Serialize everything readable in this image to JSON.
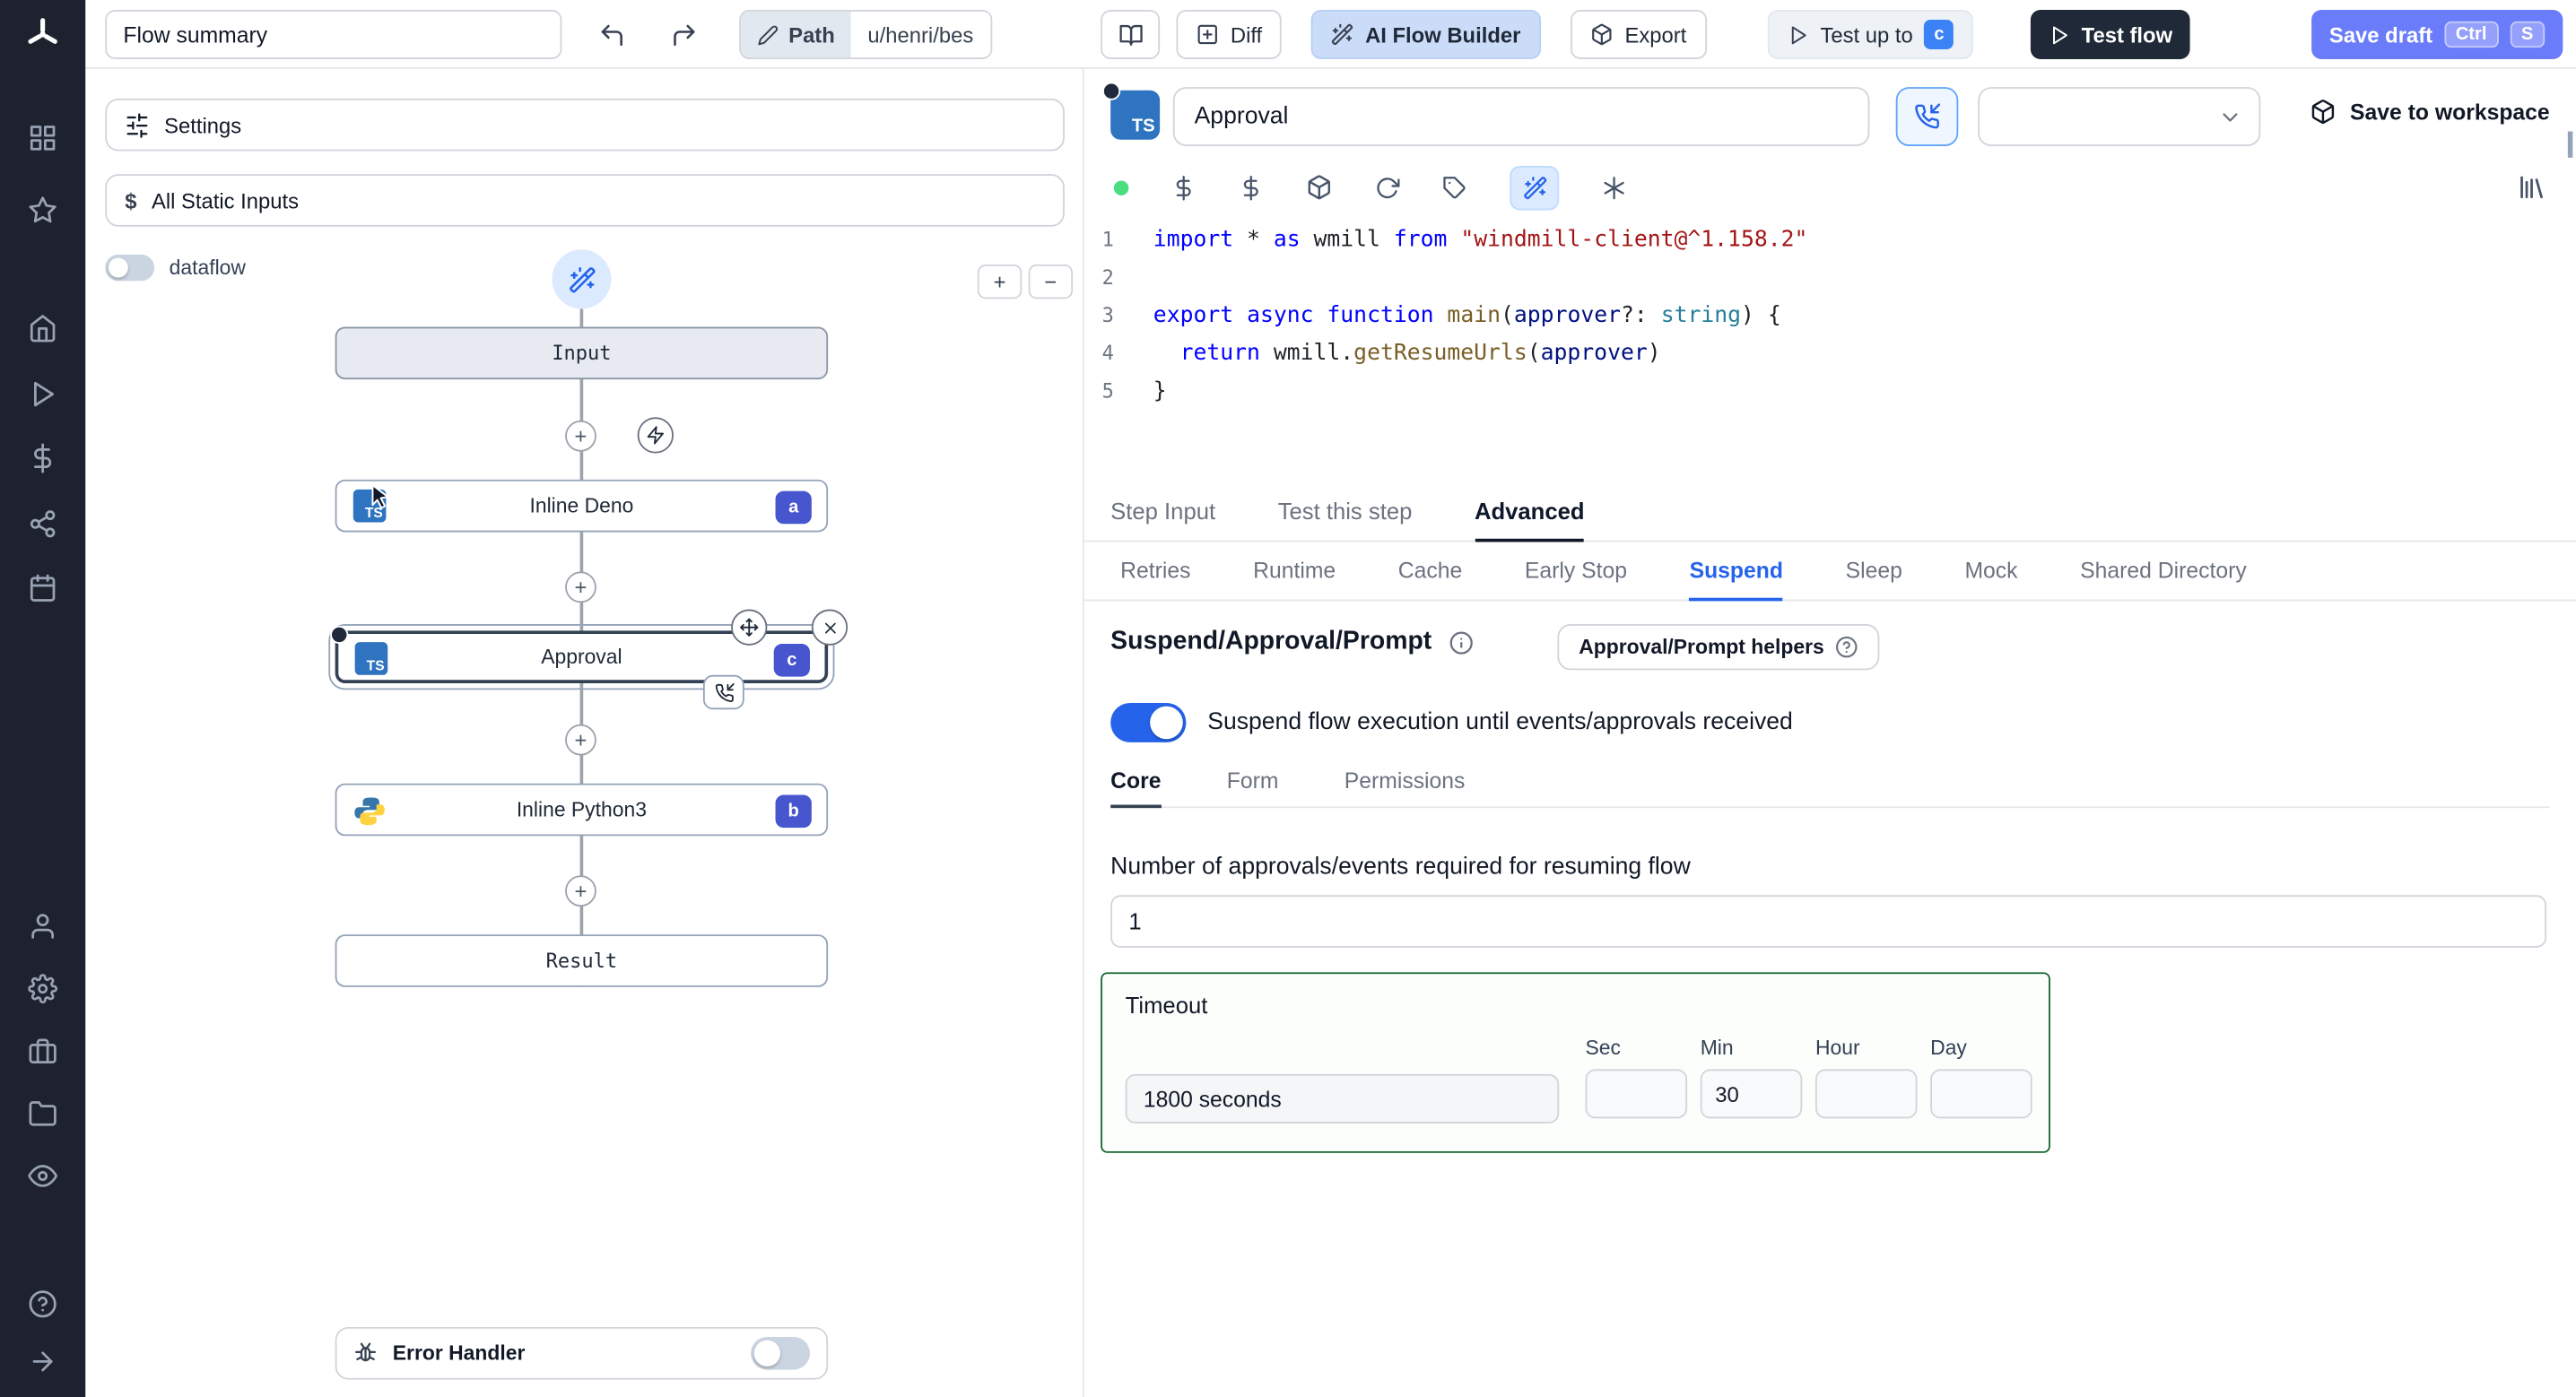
{
  "colors": {
    "accent": "#3b82f6",
    "primary_dark": "#1f2937",
    "save_draft_blue": "#6b7cfa",
    "node_badge": "#4755ce",
    "toggle_on": "#2563eb",
    "timeout_border": "#166534",
    "ts_blue": "#2f74c0",
    "lint_ok_green": "#4ade80",
    "ai_button_bg": "#cbdcf9"
  },
  "glyphs": {
    "ts": "TS",
    "plus": "+",
    "minus": "−",
    "dollar": "$"
  },
  "topbar": {
    "flow_summary_value": "Flow summary",
    "path": {
      "label": "Path",
      "value": "u/henri/bes"
    },
    "diff_label": "Diff",
    "ai_builder_label": "AI Flow Builder",
    "export_label": "Export",
    "test_up_to": {
      "label": "Test up to",
      "badge": "c"
    },
    "test_flow_label": "Test flow",
    "save_draft": {
      "label": "Save draft",
      "kbd1": "Ctrl",
      "kbd2": "S"
    }
  },
  "left_panel": {
    "settings_label": "Settings",
    "static_inputs_label": "All Static Inputs",
    "dataflow_label": "dataflow",
    "error_handler_label": "Error Handler"
  },
  "graph": {
    "input_label": "Input",
    "result_label": "Result",
    "steps": [
      {
        "label": "Inline Deno",
        "badge": "a",
        "lang": "typescript"
      },
      {
        "label": "Approval",
        "badge": "c",
        "lang": "typescript"
      },
      {
        "label": "Inline Python3",
        "badge": "b",
        "lang": "python"
      }
    ]
  },
  "editor_header": {
    "step_name": "Approval",
    "save_to_workspace_label": "Save to workspace"
  },
  "code": {
    "lines": [
      [
        [
          "kw",
          "import"
        ],
        [
          "pl",
          " * "
        ],
        [
          "kw",
          "as"
        ],
        [
          "pl",
          " wmill "
        ],
        [
          "kw",
          "from"
        ],
        [
          "pl",
          " "
        ],
        [
          "str",
          "\"windmill-client@^1.158.2\""
        ]
      ],
      [],
      [
        [
          "kw",
          "export"
        ],
        [
          "pl",
          " "
        ],
        [
          "kw",
          "async"
        ],
        [
          "pl",
          " "
        ],
        [
          "kw",
          "function"
        ],
        [
          "pl",
          " "
        ],
        [
          "fn",
          "main"
        ],
        [
          "pl",
          "("
        ],
        [
          "pm",
          "approver"
        ],
        [
          "pl",
          "?: "
        ],
        [
          "ty",
          "string"
        ],
        [
          "pl",
          ") {"
        ]
      ],
      [
        [
          "pl",
          "  "
        ],
        [
          "kw",
          "return"
        ],
        [
          "pl",
          " wmill."
        ],
        [
          "fn",
          "getResumeUrls"
        ],
        [
          "pl",
          "("
        ],
        [
          "pm",
          "approver"
        ],
        [
          "pl",
          ")"
        ]
      ],
      [
        [
          "pl",
          "}"
        ]
      ]
    ]
  },
  "tabs": {
    "main": {
      "items": [
        "Step Input",
        "Test this step",
        "Advanced"
      ],
      "active": 2
    },
    "advanced": {
      "items": [
        "Retries",
        "Runtime",
        "Cache",
        "Early Stop",
        "Suspend",
        "Sleep",
        "Mock",
        "Shared Directory"
      ],
      "active": 4
    }
  },
  "suspend": {
    "title": "Suspend/Approval/Prompt",
    "helpers_label": "Approval/Prompt helpers",
    "toggle_label": "Suspend flow execution until events/approvals received",
    "tabs": {
      "items": [
        "Core",
        "Form",
        "Permissions"
      ],
      "active": 0
    },
    "approvals_label": "Number of approvals/events required for resuming flow",
    "approvals_value": "1",
    "timeout_label": "Timeout",
    "timeout_value": "1800 seconds",
    "units": [
      {
        "label": "Sec",
        "value": ""
      },
      {
        "label": "Min",
        "value": "30"
      },
      {
        "label": "Hour",
        "value": ""
      },
      {
        "label": "Day",
        "value": ""
      }
    ]
  }
}
